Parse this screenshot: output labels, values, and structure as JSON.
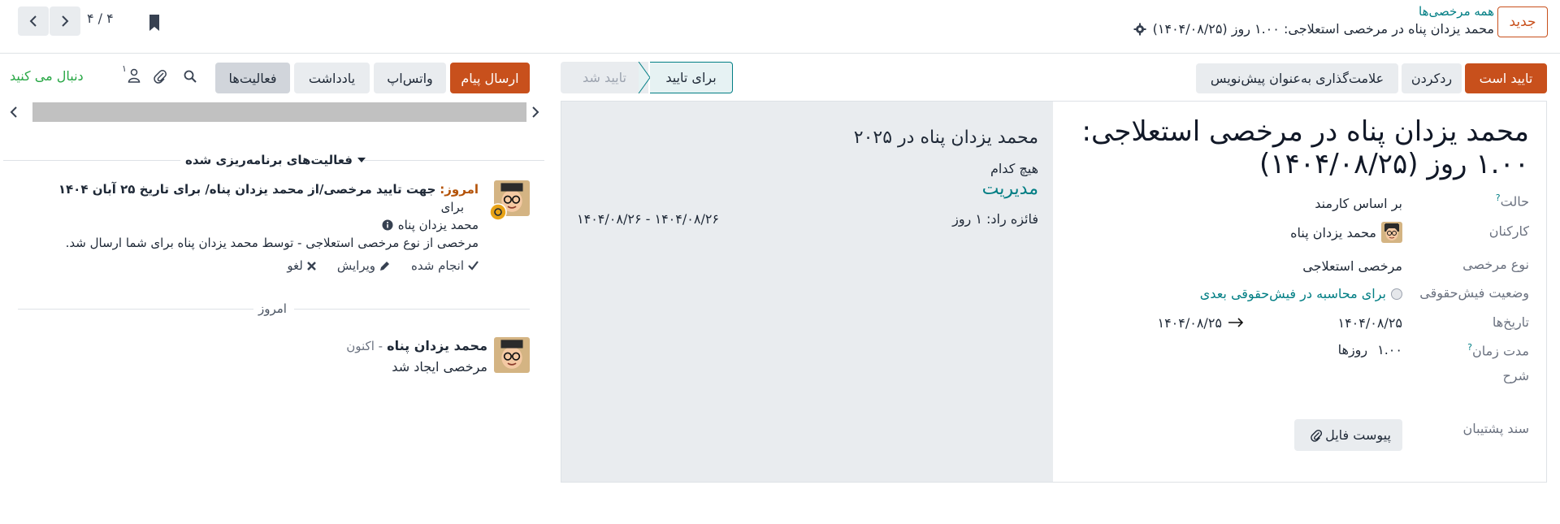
{
  "header": {
    "new_button": "جدید",
    "breadcrumb_parent": "همه مرخصی‌ها",
    "record_title": "محمد یزدان پناه در مرخصی استعلاجی: ۱.۰۰ روز (۱۴۰۴/۰۸/۲۵)",
    "pager_value": "۴ / ۴"
  },
  "actions": {
    "approve": "تایید است",
    "refuse": "ردکردن",
    "mark_draft": "علامت‌گذاری به‌عنوان پیش‌نویس"
  },
  "status": {
    "to_approve": "برای تایید",
    "approved": "تایید شد"
  },
  "chatter_actions": {
    "send_message": "ارسال پیام",
    "whatsapp": "واتس‌اپ",
    "log_note": "یادداشت",
    "activities": "فعالیت‌ها",
    "follower_count": "۱",
    "follow": "دنبال می کنید"
  },
  "form": {
    "title": "محمد یزدان پناه در مرخصی استعلاجی: ۱.۰۰ روز (۱۴۰۴/۰۸/۲۵)",
    "fields": {
      "mode_label": "حالت",
      "mode_value": "بر اساس کارمند",
      "employees_label": "کارکنان",
      "employees_value": "محمد یزدان پناه",
      "leave_type_label": "نوع مرخصی",
      "leave_type_value": "مرخصی استعلاجی",
      "payslip_label": "وضعیت فیش‌حقوقی",
      "payslip_value": "برای محاسبه در فیش‌حقوقی بعدی",
      "dates_label": "تاریخ‌ها",
      "date_from": "۱۴۰۴/۰۸/۲۵",
      "date_to": "۱۴۰۴/۰۸/۲۵",
      "duration_label": "مدت زمان",
      "duration_value": "۱.۰۰",
      "duration_unit": "روزها",
      "description_label": "شرح",
      "support_doc_label": "سند پشتیبان",
      "attach_button": "پیوست فایل"
    },
    "side_panel": {
      "title": "محمد یزدان پناه در ۲۰۲۵",
      "none": "هیچ کدام",
      "manager": "مدیریت",
      "reward": "فائزه راد: ۱ روز",
      "range": "۱۴۰۴/۰۸/۲۶ - ۱۴۰۴/۰۸/۲۶"
    }
  },
  "chatter": {
    "planned_activities": "فعالیت‌های برنامه‌ریزی شده",
    "activity": {
      "due": "امروز:",
      "summary": "جهت تایید مرخصی/از محمد یزدان پناه/ برای تاریخ ۲۵ آبان ۱۴۰۴",
      "for_label": "برای",
      "assignee": "محمد یزدان پناه",
      "body": "مرخصی از نوع مرخصی استعلاجی - توسط محمد یزدان پناه برای شما ارسال شد.",
      "done": "انجام شده",
      "edit": "ویرایش",
      "cancel": "لغو"
    },
    "today_separator": "امروز",
    "message": {
      "author": "محمد یزدان پناه",
      "time": "- اکنون",
      "body": "مرخصی ایجاد شد"
    }
  },
  "colors": {
    "primary": "#c8501c",
    "teal": "#017e84",
    "follow_green": "#28a745"
  }
}
